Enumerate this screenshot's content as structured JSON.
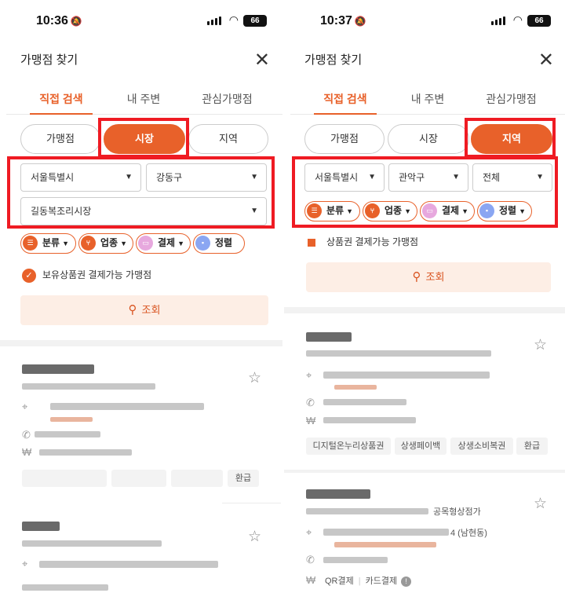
{
  "left": {
    "status": {
      "time": "10:36",
      "battery": "66"
    },
    "title": "가맹점 찾기",
    "close_icon": "✕",
    "tabs": [
      "직접 검색",
      "내 주변",
      "관심가맹점"
    ],
    "segments": [
      "가맹점",
      "시장",
      "지역"
    ],
    "selected_segment": "시장",
    "selects": {
      "city": "서울특별시",
      "district": "강동구",
      "market": "길동복조리시장"
    },
    "filters": [
      "분류",
      "업종",
      "결제",
      "정렬"
    ],
    "checkbox_label": "보유상품권 결제가능 가맹점",
    "search_label": "조회",
    "result1": {
      "tag_last": "환급"
    }
  },
  "right": {
    "status": {
      "time": "10:37",
      "battery": "66"
    },
    "title": "가맹점 찾기",
    "close_icon": "✕",
    "tabs": [
      "직접 검색",
      "내 주변",
      "관심가맹점"
    ],
    "segments": [
      "가맹점",
      "시장",
      "지역"
    ],
    "selected_segment": "지역",
    "selects": {
      "city": "서울특별시",
      "district": "관악구",
      "dong": "전체"
    },
    "filters": [
      "분류",
      "업종",
      "결제",
      "정렬"
    ],
    "checkbox_label": "상품권 결제가능 가맹점",
    "search_label": "조회",
    "result1": {
      "tags": [
        "디지털온누리상품권",
        "상생페이백",
        "상생소비복권",
        "환급"
      ]
    },
    "result2": {
      "addr_tail": "4 (남현동)",
      "addr_tail2": "공목형상점가",
      "payments": [
        "QR결제",
        "카드결제"
      ],
      "info_icon": "!"
    }
  },
  "colors": {
    "accent": "#e8612a",
    "highlight_box": "#ef1b23",
    "search_bg": "#fdeee5"
  },
  "icons": {
    "search": "⚲",
    "star": "☆",
    "check": "✓",
    "caret": "▼"
  }
}
